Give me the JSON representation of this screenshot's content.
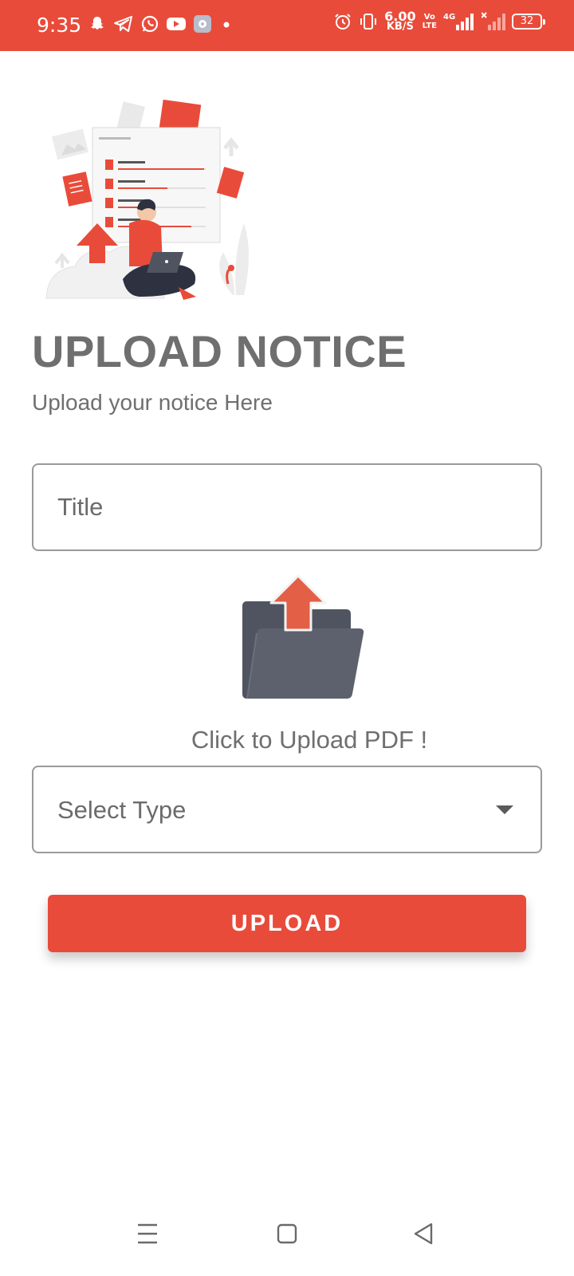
{
  "status_bar": {
    "time": "9:35",
    "net_speed_value": "6.00",
    "net_speed_unit": "KB/S",
    "volte_top": "Vo",
    "volte_bottom": "LTE",
    "network_type": "4G",
    "battery": "32",
    "left_icons": [
      "snapchat-icon",
      "telegram-icon",
      "whatsapp-icon",
      "youtube-icon",
      "settings-app-icon",
      "dot-icon"
    ],
    "right_icons": [
      "alarm-icon",
      "vibrate-icon",
      "signal-icon",
      "signal-off-icon",
      "battery-icon"
    ]
  },
  "hero": {
    "illustration": "person-uploading-files"
  },
  "header": {
    "title": "UPLOAD NOTICE",
    "subtitle": "Upload your notice Here"
  },
  "form": {
    "title_placeholder": "Title",
    "upload_pdf_label": "Click to Upload PDF !",
    "select_type_value": "Select Type",
    "upload_button_label": "UPLOAD"
  },
  "nav_bar": {
    "buttons": [
      "menu-icon",
      "home-icon",
      "back-icon"
    ]
  },
  "colors": {
    "accent": "#E94B3A",
    "text_gray": "#6f6f6f",
    "folder": "#4f5460"
  }
}
